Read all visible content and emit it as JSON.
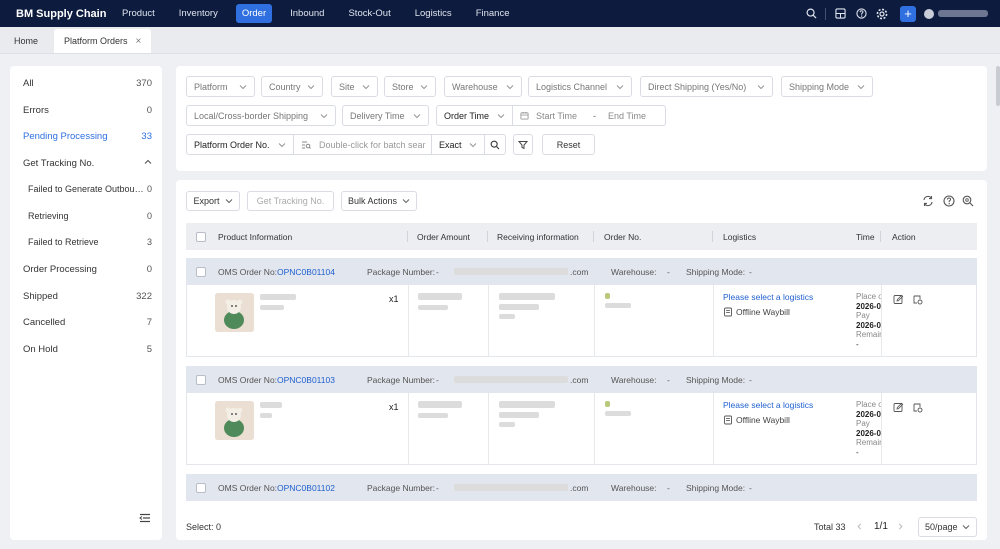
{
  "brand": "BM Supply Chain",
  "nav": [
    "Product",
    "Inventory",
    "Order",
    "Inbound",
    "Stock-Out",
    "Logistics",
    "Finance"
  ],
  "nav_active": "Order",
  "tabs": [
    {
      "label": "Home"
    },
    {
      "label": "Platform Orders",
      "close": "×"
    }
  ],
  "sidebar": {
    "all": {
      "label": "All",
      "count": "370"
    },
    "errors": {
      "label": "Errors",
      "count": "0"
    },
    "pending": {
      "label": "Pending Processing",
      "count": "33"
    },
    "get_tracking": {
      "label": "Get Tracking No."
    },
    "failed_generate": {
      "label": "Failed to Generate Outboun...",
      "count": "0"
    },
    "retrieving": {
      "label": "Retrieving",
      "count": "0"
    },
    "failed_retrieve": {
      "label": "Failed to Retrieve",
      "count": "3"
    },
    "order_processing": {
      "label": "Order Processing",
      "count": "0"
    },
    "shipped": {
      "label": "Shipped",
      "count": "322"
    },
    "cancelled": {
      "label": "Cancelled",
      "count": "7"
    },
    "on_hold": {
      "label": "On Hold",
      "count": "5"
    }
  },
  "filters": {
    "platform": "Platform",
    "country": "Country",
    "site": "Site",
    "store": "Store",
    "warehouse": "Warehouse",
    "logistics_channel": "Logistics Channel",
    "direct_shipping": "Direct Shipping (Yes/No)",
    "shipping_mode": "Shipping Mode",
    "local_cross": "Local/Cross-border Shipping",
    "delivery_time": "Delivery Time",
    "order_time": "Order Time",
    "start_time": "Start Time",
    "range_sep": "-",
    "end_time": "End Time",
    "platform_order_no": "Platform Order No.",
    "batch_placeholder": "Double-click for batch sear",
    "exact": "Exact",
    "reset": "Reset"
  },
  "toolbar": {
    "export": "Export",
    "get_tracking": "Get Tracking No.",
    "bulk_actions": "Bulk Actions"
  },
  "columns": {
    "product": "Product Information",
    "amount": "Order Amount",
    "receiving": "Receiving information",
    "order_no": "Order No.",
    "logistics": "Logistics",
    "time": "Time",
    "action": "Action"
  },
  "order_labels": {
    "oms": "OMS Order No:",
    "package": "Package Number:",
    "package_value": "-",
    "email_suffix": ".com",
    "warehouse": "Warehouse:",
    "warehouse_value": "-",
    "shipping_mode": "Shipping Mode:",
    "shipping_mode_value": "-",
    "qty": "x1",
    "select_logistics": "Please select a logistics",
    "offline_waybill": "Offline Waybill",
    "place": "Place o",
    "date": "2026-0",
    "pay": "Pay",
    "remain": "Remain",
    "dash": "-"
  },
  "orders": [
    {
      "oms_no": "OPNC0B01104"
    },
    {
      "oms_no": "OPNC0B01103"
    },
    {
      "oms_no": "OPNC0B01102"
    }
  ],
  "footer": {
    "select": "Select: 0",
    "total": "Total 33",
    "page": "1/1",
    "per_page": "50/page"
  }
}
